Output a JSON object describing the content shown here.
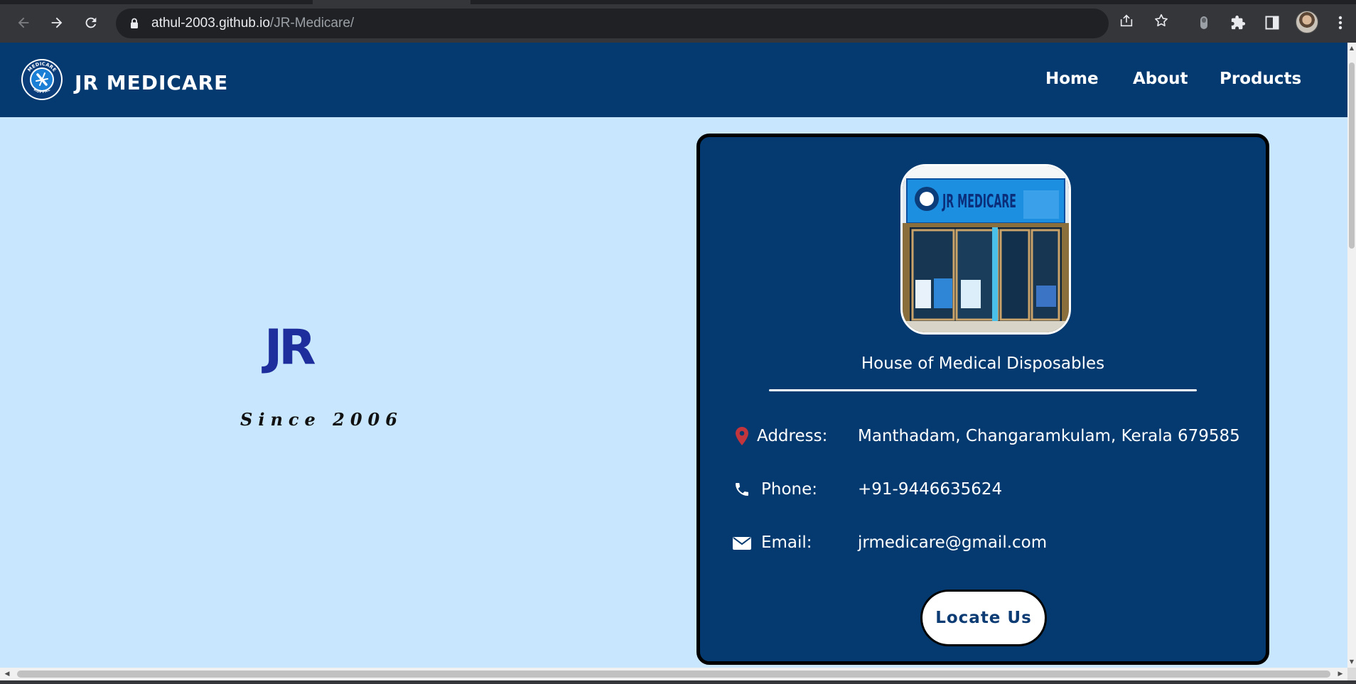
{
  "browser": {
    "url_host": "athul-2003.github.io",
    "url_path": "/JR-Medicare/",
    "back_icon": "arrow-left-icon",
    "forward_icon": "arrow-right-icon",
    "reload_icon": "reload-icon",
    "lock_icon": "lock-icon",
    "share_icon": "share-icon",
    "bookmark_icon": "star-icon",
    "extension_icon": "puzzle-icon",
    "side_panel_icon": "side-panel-icon",
    "menu_icon": "kebab-menu-icon"
  },
  "navbar": {
    "brand": "JR MEDICARE",
    "logo_top_text": "MEDICARE",
    "logo_bottom_text": "KOPPAL",
    "links": [
      "Home",
      "About",
      "Products"
    ]
  },
  "hero": {
    "title": "JR",
    "subtitle": "Since 2006"
  },
  "card": {
    "sign_text": "JR MEDICARE",
    "tagline": "House of Medical Disposables",
    "rows": [
      {
        "icon": "map-pin-icon",
        "label": "Address:",
        "value": "Manthadam, Changaramkulam, Kerala 679585"
      },
      {
        "icon": "phone-icon",
        "label": "Phone:",
        "value": "+91-9446635624"
      },
      {
        "icon": "envelope-icon",
        "label": "Email:",
        "value": "jrmedicare@gmail.com"
      }
    ],
    "button": "Locate Us"
  },
  "colors": {
    "navbar_bg": "#043a6f",
    "page_bg": "#c8e6fd",
    "hero_title": "#1e2e9c",
    "pin": "#c2353d"
  }
}
